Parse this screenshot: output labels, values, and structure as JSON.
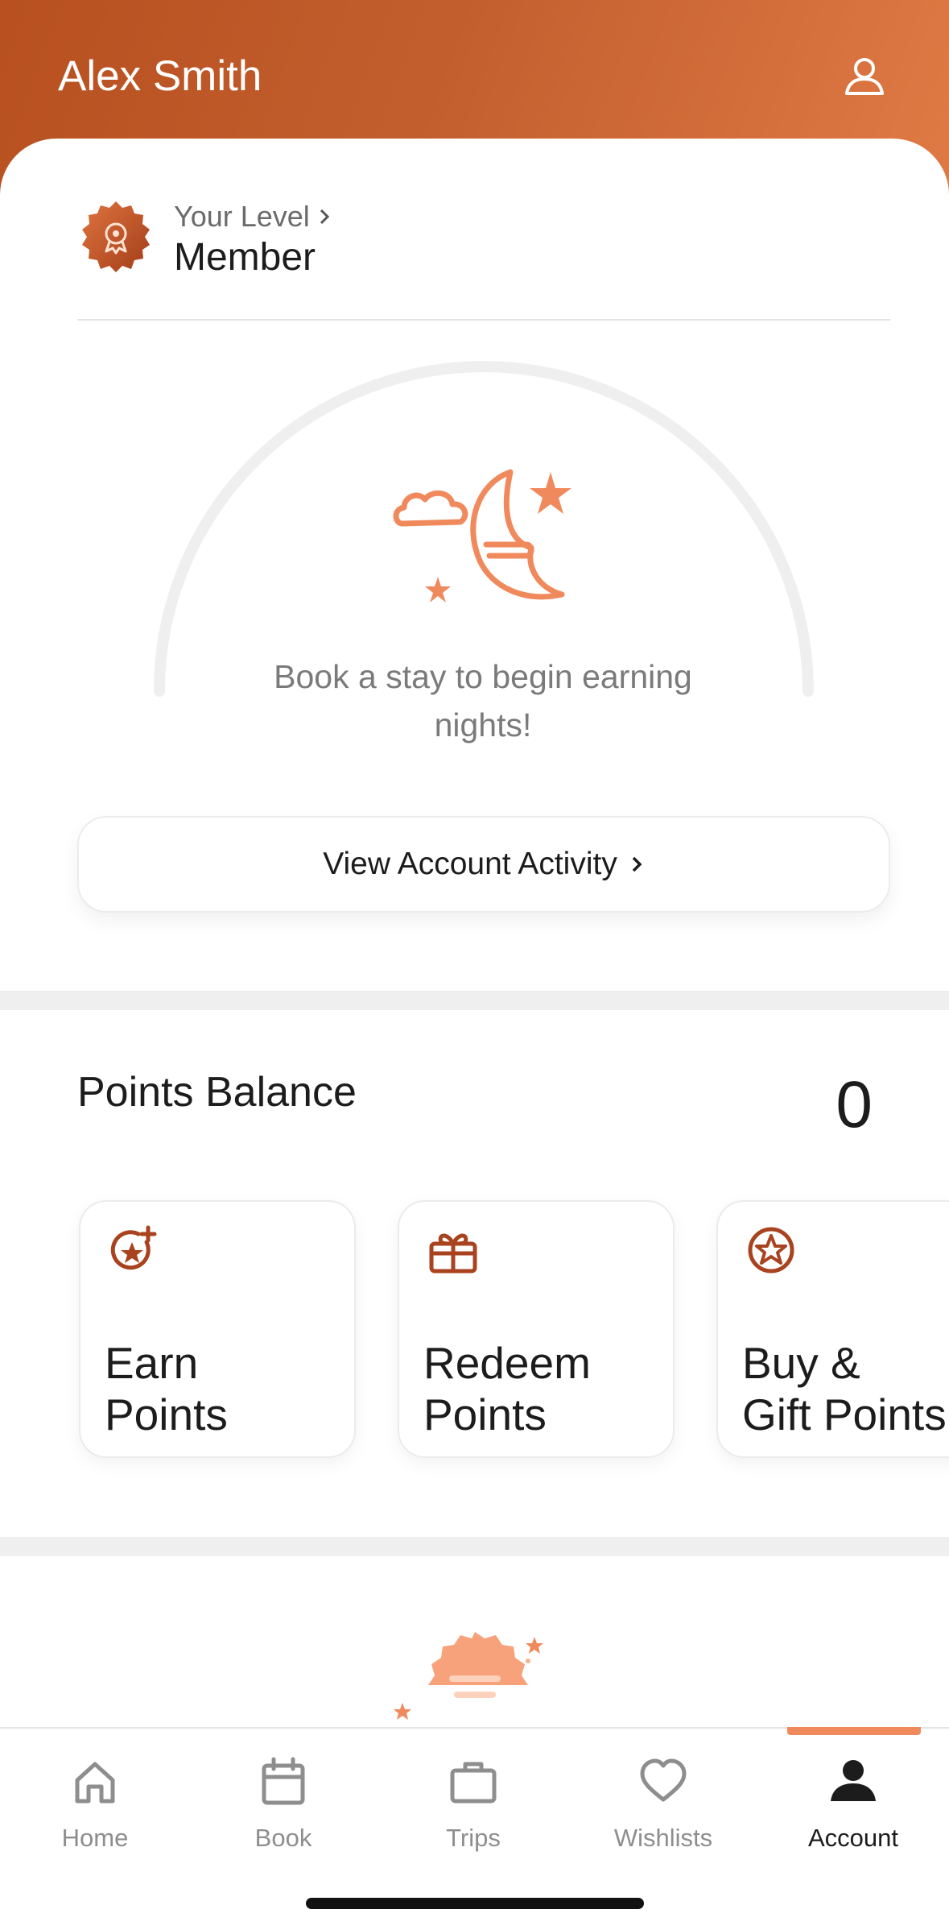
{
  "header": {
    "user_name": "Alex Smith",
    "profile_icon": "person-icon"
  },
  "level": {
    "caption": "Your Level",
    "value": "Member",
    "badge_icon": "award-badge-icon"
  },
  "progress": {
    "message": "Book a stay to begin earning nights!",
    "illustration": "moon-cloud-stars-icon",
    "nights_progress": 0
  },
  "activity_button": {
    "label": "View Account Activity"
  },
  "points": {
    "title": "Points Balance",
    "value": "0",
    "cards": [
      {
        "label": "Earn\nPoints",
        "icon": "star-plus-icon"
      },
      {
        "label": "Redeem\nPoints",
        "icon": "gift-icon"
      },
      {
        "label": "Buy &\nGift Points",
        "icon": "star-circle-icon"
      }
    ]
  },
  "tabbar": {
    "items": [
      {
        "label": "Home",
        "icon": "home-icon"
      },
      {
        "label": "Book",
        "icon": "calendar-icon"
      },
      {
        "label": "Trips",
        "icon": "briefcase-icon"
      },
      {
        "label": "Wishlists",
        "icon": "heart-icon"
      },
      {
        "label": "Account",
        "icon": "person-filled-icon"
      }
    ],
    "active": "Account"
  },
  "colors": {
    "brand": "#c25e2e",
    "accent": "#f08a5d",
    "icon_brown": "#a9431f"
  }
}
